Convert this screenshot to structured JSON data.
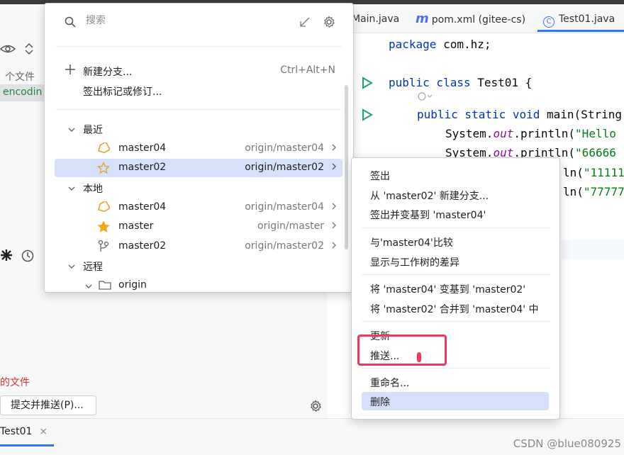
{
  "left_panel": {
    "files_label": "个文件",
    "encoding_label": "encodin",
    "changed_files_label": "的文件",
    "commit_push_button": "提交并推送(P)..."
  },
  "bottom": {
    "tab_label": "Test01",
    "tab_close": "×",
    "watermark": "CSDN @blue080925"
  },
  "editor_tabs": [
    {
      "label": "Main.java"
    },
    {
      "label": "pom.xml (gitee-cs)",
      "icon_text": "m"
    },
    {
      "label": "Test01.java",
      "icon_text": "C"
    }
  ],
  "code": {
    "line1_kw": "package",
    "line1_rest": " com.hz;",
    "line2_kw": "public class",
    "line2_rest": " Test01 {",
    "line3_kw": "public static void",
    "line3_rest": " main(String",
    "line4_a": "System.",
    "line4_fld": "out",
    "line4_b": ".println(",
    "line4_str": "\"Hello",
    "line5_a": "System.",
    "line5_fld": "out",
    "line5_b": ".println(",
    "line5_str": "\"66666",
    "line6_b": "ln(",
    "line6_str": "\"11111",
    "line7_b": "ln(",
    "line7_str": "\"77777"
  },
  "popup": {
    "search_placeholder": "搜索",
    "actions": [
      {
        "label": "新建分支...",
        "shortcut": "Ctrl+Alt+N"
      },
      {
        "label": "签出标记或修订..."
      }
    ],
    "recent_header": "最近",
    "recent": [
      {
        "name": "master04",
        "remote": "origin/master04",
        "icon": "tag-icon"
      },
      {
        "name": "master02",
        "remote": "origin/master02",
        "icon": "star-outline-icon"
      }
    ],
    "local_header": "本地",
    "local": [
      {
        "name": "master04",
        "remote": "origin/master04",
        "icon": "tag-icon"
      },
      {
        "name": "master",
        "remote": "origin/master",
        "icon": "star-filled-icon"
      },
      {
        "name": "master02",
        "remote": "origin/master02",
        "icon": "branch-icon"
      }
    ],
    "remote_header": "远程",
    "remote_origin": "origin"
  },
  "context_menu": {
    "items": [
      "签出",
      "从 'master02' 新建分支...",
      "签出并变基到 'master04'",
      "与'master04'比较",
      "显示与工作树的差异",
      "将 'master04' 变基到 'master02'",
      "将 'master02' 合并到 'master04' 中",
      "更新",
      "推送...",
      "重命名...",
      "删除"
    ]
  },
  "colors": {
    "accent": "#3574f0",
    "selection": "#d5e1fb",
    "highlight_box": "#f2395b",
    "run_green": "#21a366",
    "star": "#f3a712",
    "tag": "#e4a11b"
  }
}
